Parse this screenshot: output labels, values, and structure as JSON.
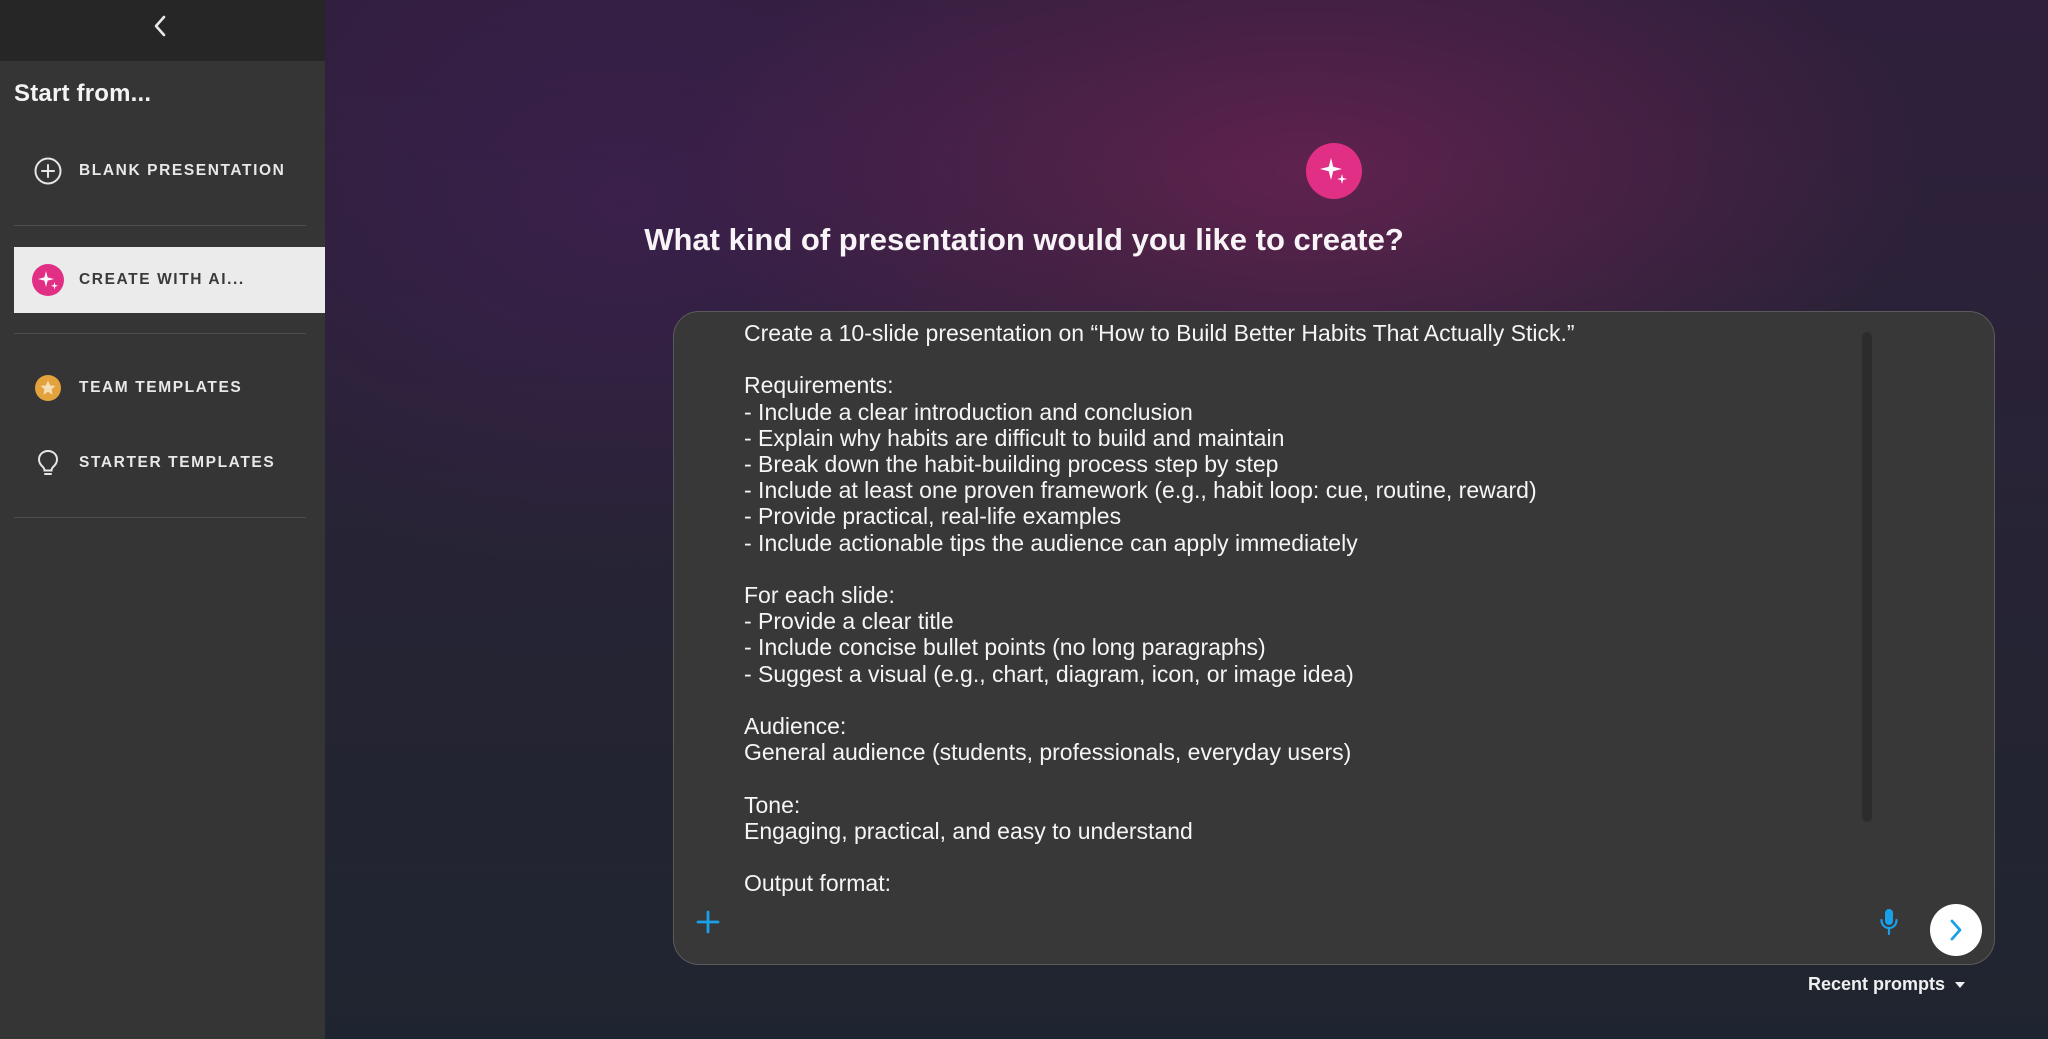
{
  "sidebar": {
    "heading": "Start from...",
    "items": [
      {
        "label": "BLANK PRESENTATION",
        "icon": "plus-circle-icon"
      },
      {
        "label": "CREATE WITH AI...",
        "icon": "sparkle-icon",
        "active": true
      },
      {
        "label": "TEAM TEMPLATES",
        "icon": "star-badge-icon"
      },
      {
        "label": "STARTER TEMPLATES",
        "icon": "lightbulb-icon"
      }
    ]
  },
  "main": {
    "title": "What kind of presentation would you like to create?",
    "prompt": "Create a 10-slide presentation on “How to Build Better Habits That Actually Stick.”\n\nRequirements:\n- Include a clear introduction and conclusion\n- Explain why habits are difficult to build and maintain\n- Break down the habit-building process step by step\n- Include at least one proven framework (e.g., habit loop: cue, routine, reward)\n- Provide practical, real-life examples\n- Include actionable tips the audience can apply immediately\n\nFor each slide:\n- Provide a clear title\n- Include concise bullet points (no long paragraphs)\n- Suggest a visual (e.g., chart, diagram, icon, or image idea)\n\nAudience:\nGeneral audience (students, professionals, everyday users)\n\nTone:\nEngaging, practical, and easy to understand\n\nOutput format:",
    "recent_prompts_label": "Recent prompts"
  },
  "colors": {
    "accent_pink": "#e22f86",
    "accent_blue": "#1aa0e6",
    "team_orange": "#e4a23c",
    "sidebar_bg": "#353535",
    "active_item_bg": "#ebebeb"
  }
}
